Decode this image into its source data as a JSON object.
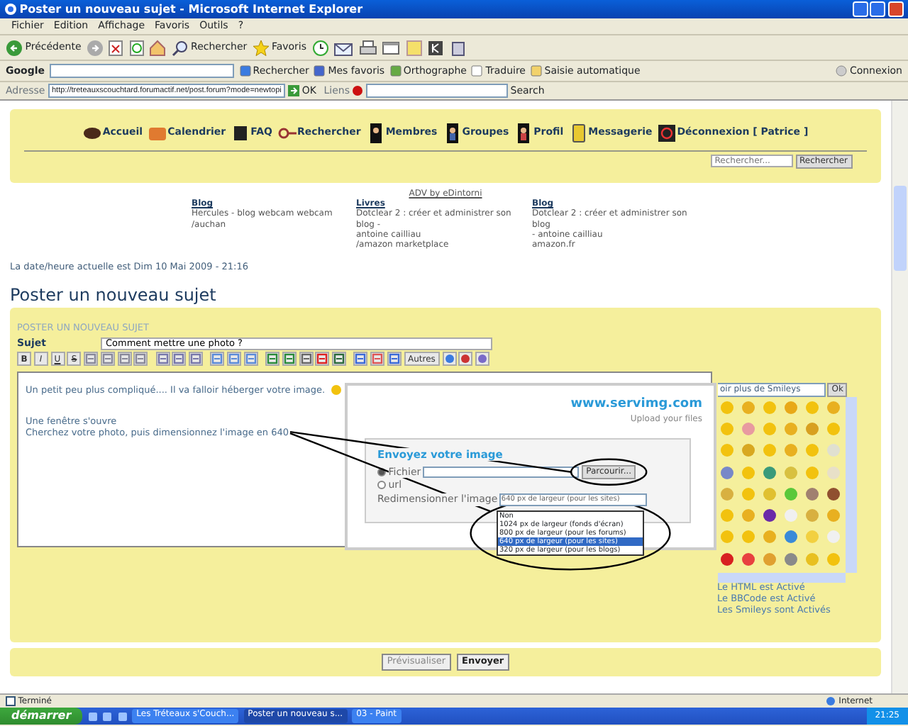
{
  "window": {
    "title": "Poster un nouveau sujet - Microsoft Internet Explorer"
  },
  "menu": [
    "Fichier",
    "Edition",
    "Affichage",
    "Favoris",
    "Outils",
    "?"
  ],
  "toolbar": {
    "back": "Précédente",
    "search": "Rechercher",
    "favorites": "Favoris"
  },
  "google_bar": {
    "logo": "Google",
    "items": [
      "Rechercher",
      "Mes favoris",
      "Orthographe",
      "Traduire",
      "Saisie automatique"
    ],
    "login": "Connexion"
  },
  "address_bar": {
    "label": "Adresse",
    "url": "http://treteauxscouchtard.forumactif.net/post.forum?mode=newtopi",
    "go": "OK",
    "links": "Liens",
    "search": "Search"
  },
  "forum_nav": [
    "Accueil",
    "Calendrier",
    "FAQ",
    "Rechercher",
    "Membres",
    "Groupes",
    "Profil",
    "Messagerie",
    "Déconnexion [ Patrice ]"
  ],
  "forum_search": {
    "placeholder": "Rechercher...",
    "button": "Rechercher"
  },
  "ads": {
    "title": "ADV by eDintorni",
    "items": [
      {
        "heading": "Blog",
        "lines": [
          "Hercules - blog webcam webcam",
          "/auchan"
        ]
      },
      {
        "heading": "Livres",
        "lines": [
          "Dotclear 2 : créer et administrer son blog -",
          "antoine cailliau",
          "/amazon marketplace"
        ]
      },
      {
        "heading": "Blog",
        "lines": [
          "Dotclear 2 : créer et administrer son blog",
          "- antoine cailliau",
          "amazon.fr"
        ]
      }
    ]
  },
  "date_line": "La date/heure actuelle est Dim 10 Mai 2009 - 21:16",
  "page_title": "Poster un nouveau sujet",
  "form": {
    "section": "POSTER UN NOUVEAU SUJET",
    "subject_label": "Sujet",
    "subject_value": "Comment mettre une photo ?",
    "format_buttons": [
      "B",
      "I",
      "U",
      "S"
    ],
    "other_button": "Autres",
    "body_lines": [
      "Un petit peu plus compliqué.... Il va falloir héberger votre image.",
      "Une fenêtre s'ouvre",
      "Cherchez votre photo, puis dimensionnez l'image en 640"
    ]
  },
  "upload_dialog": {
    "logo": "www.servimg.com",
    "tagline": "Upload your files",
    "heading": "Envoyez votre image",
    "sources": [
      {
        "label": "Fichier",
        "selected": true
      },
      {
        "label": "url",
        "selected": false
      }
    ],
    "browse": "Parcourir...",
    "resize_label": "Redimensionner l'image",
    "resize_value": "640 px de largeur (pour les sites)",
    "resize_options": [
      {
        "label": "Non",
        "selected": false
      },
      {
        "label": "1024 px de largeur (fonds d'écran)",
        "selected": false
      },
      {
        "label": "800 px de largeur (pour les forums)",
        "selected": false
      },
      {
        "label": "640 px de largeur (pour les sites)",
        "selected": true
      },
      {
        "label": "320 px de largeur (pour les blogs)",
        "selected": false
      }
    ]
  },
  "smileys": {
    "more": "oir plus de Smileys",
    "ok": "Ok",
    "status": [
      "Le HTML est Activé",
      "Le BBCode est Activé",
      "Les Smileys sont Activés"
    ]
  },
  "buttons": [
    "Prévisualiser",
    "Envoyer"
  ],
  "status_bar": {
    "text": "Terminé",
    "zone": "Internet"
  },
  "taskbar": {
    "start": "démarrer",
    "tasks": [
      {
        "label": "Les Tréteaux s'Couch...",
        "selected": false
      },
      {
        "label": "Poster un nouveau s...",
        "selected": true
      },
      {
        "label": "03 - Paint",
        "selected": false
      }
    ],
    "clock": "21:25"
  }
}
